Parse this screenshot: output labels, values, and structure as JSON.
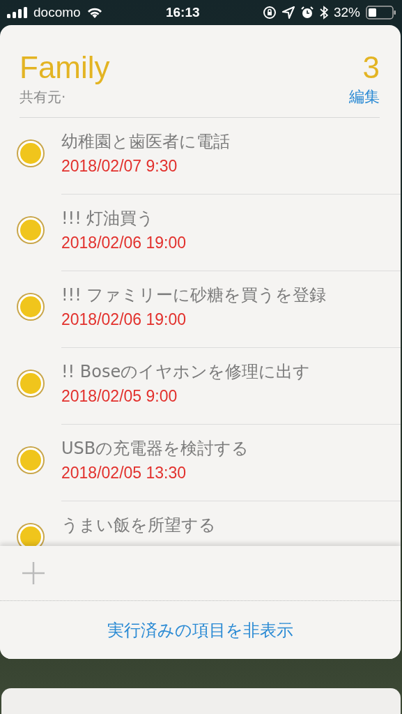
{
  "status_bar": {
    "carrier": "docomo",
    "time": "16:13",
    "battery": "32%"
  },
  "list": {
    "title": "Family",
    "count": "3",
    "shared_by": "共有元·",
    "edit": "編集"
  },
  "items": [
    {
      "title": "幼稚園と歯医者に電話",
      "due": "2018/02/07 9:30"
    },
    {
      "title": "!!! 灯油買う",
      "due": "2018/02/06 19:00"
    },
    {
      "title": "!!! ファミリーに砂糖を買うを登録",
      "due": "2018/02/06 19:00"
    },
    {
      "title": "!! Boseのイヤホンを修理に出す",
      "due": "2018/02/05 9:00"
    },
    {
      "title": "USBの充電器を検討する",
      "due": "2018/02/05 13:30"
    },
    {
      "title": "うまい飯を所望する"
    }
  ],
  "hide_completed": "実行済みの項目を非表示"
}
